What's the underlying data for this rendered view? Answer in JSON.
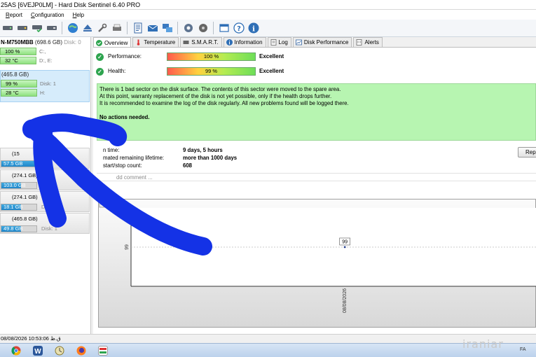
{
  "window": {
    "title": "25AS [6VEJP0LM]  -  Hard Disk Sentinel 6.40 PRO"
  },
  "menu": [
    "Report",
    "Configuration",
    "Help"
  ],
  "toolbar": {
    "icons": [
      "disk-status-icon",
      "disk-temp-icon",
      "disk-ok-icon",
      "disk-test-icon",
      "globe-icon",
      "eject-icon",
      "tools-icon",
      "print-icon",
      "report-icon",
      "mail-icon",
      "network-icon",
      "settings-icon",
      "gear-icon",
      "window-icon",
      "help-icon",
      "info-icon"
    ]
  },
  "disks": [
    {
      "title": "N-M750MBB",
      "size": "(698.6 GB)",
      "disk": "Disk: 0",
      "health": "100 %",
      "health_label": "C:,",
      "temp": "32 °C",
      "temp_label": "D:, E:"
    },
    {
      "size": "(465.8 GB)",
      "health": "99 %",
      "health_label": "Disk: 1",
      "temp": "28 °C",
      "temp_label": "H:"
    }
  ],
  "volumes": [
    {
      "size": "(15",
      "used": "57.5 GB",
      "fill": 0.95,
      "label": ""
    },
    {
      "size": "(274.1 GB)",
      "used": "103.0 GB",
      "fill": 0.38,
      "label": ""
    },
    {
      "size": "(274.1 GB)",
      "used": "18.1 GB",
      "fill": 0.07,
      "label": "Di"
    },
    {
      "size": "(465.8 GB)",
      "used": "49.8 GB",
      "fill": 0.11,
      "label": "Disk: 1"
    }
  ],
  "tabs": [
    {
      "label": "Overview",
      "icon": "check-icon",
      "active": true
    },
    {
      "label": "Temperature",
      "icon": "thermometer-icon"
    },
    {
      "label": "S.M.A.R.T.",
      "icon": "smart-icon"
    },
    {
      "label": "Information",
      "icon": "info-icon"
    },
    {
      "label": "Log",
      "icon": "log-icon"
    },
    {
      "label": "Disk Performance",
      "icon": "performance-icon"
    },
    {
      "label": "Alerts",
      "icon": "alert-icon"
    }
  ],
  "overview": {
    "performance": {
      "label": "Performance:",
      "value": "100 %",
      "rating": "Excellent",
      "level": 1.0
    },
    "health": {
      "label": "Health:",
      "value": "99 %",
      "rating": "Excellent",
      "level": 0.99
    },
    "message": [
      "There is 1 bad sector on the disk surface. The contents of this sector were moved to the spare area.",
      "At this point, warranty replacement of the disk is not yet possible, only if the health drops further.",
      "It is recommended to examine the log of the disk regularly. All new problems found will be logged there."
    ],
    "message_bold": "No actions needed.",
    "info": [
      {
        "key": "n time:",
        "value": "9 days, 5 hours"
      },
      {
        "key": "mated remaining lifetime:",
        "value": "more than 1000 days"
      },
      {
        "key": "start/stop count:",
        "value": "608"
      }
    ],
    "report_button": "Rep",
    "comment_placeholder": "dd comment ..."
  },
  "chart_data": {
    "type": "line",
    "title": "",
    "xlabel": "",
    "ylabel": "",
    "x": [
      "08/08/2026"
    ],
    "series": [
      {
        "values": [
          99
        ]
      }
    ],
    "ytick": "99",
    "point_label": "99"
  },
  "statusbar": {
    "text": "08/08/2026 10:53:06 ق.ظ"
  },
  "taskbar": {
    "icons": [
      "chrome-icon",
      "word-icon",
      "clock-icon",
      "firefox-icon",
      "hds-icon"
    ],
    "tray": "FA"
  },
  "watermark": "iraniar"
}
